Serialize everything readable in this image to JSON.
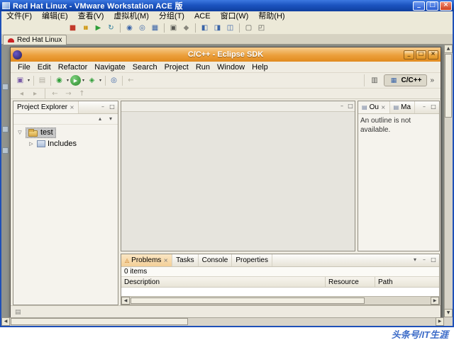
{
  "vmware": {
    "title": "Red Hat Linux - VMware Workstation ACE 版",
    "menu": [
      "文件(F)",
      "编辑(E)",
      "查看(V)",
      "虚拟机(M)",
      "分组(T)",
      "ACE",
      "窗口(W)",
      "帮助(H)"
    ],
    "tab_label": "Red Hat Linux"
  },
  "eclipse": {
    "title": "C/C++ - Eclipse SDK",
    "menu": [
      "File",
      "Edit",
      "Refactor",
      "Navigate",
      "Search",
      "Project",
      "Run",
      "Window",
      "Help"
    ],
    "perspective": "C/C++",
    "project_explorer": {
      "title": "Project Explorer",
      "project": "test",
      "child": "Includes"
    },
    "outline": {
      "tab_outline": "Ou",
      "tab_make": "Ma",
      "message": "An outline is not available."
    },
    "bottom": {
      "tab_problems": "Problems",
      "tab_tasks": "Tasks",
      "tab_console": "Console",
      "tab_properties": "Properties",
      "items_label": "0 items",
      "col_description": "Description",
      "col_resource": "Resource",
      "col_path": "Path"
    }
  },
  "watermark": "头条号/IT生涯",
  "glyphs": {
    "minimize": "_",
    "maximize": "□",
    "close": "×",
    "power_off": "■",
    "suspend": "▮▮",
    "power_on": "▶",
    "reset": "↻",
    "snapshot": "◉",
    "revert_snapshot": "◎",
    "snapshot_manager": "▦",
    "settings": "▣",
    "clone": "◆",
    "summary_view": "◧",
    "console_view": "◨",
    "devices_view": "◫",
    "fullscreen": "▢",
    "quick_switch": "◰",
    "new_wizard": "▣",
    "save": "▤",
    "debug": "◉",
    "run": "▶",
    "external_tools": "◈",
    "search": "◎",
    "dropdown": "▾",
    "back": "←",
    "forward": "→",
    "up_arrow": "↑",
    "prev": "◂",
    "next": "▸",
    "collapse_all": "▴",
    "view_menu": "▾",
    "min_view": "–",
    "max_view": "□",
    "tab_close": "×",
    "problems_icon": "◬",
    "view_tab_icon": "▤",
    "view_layout": "▥",
    "persp_icon": "▦",
    "overflow": "»",
    "status_icon": "▤",
    "scroll_up": "▲",
    "scroll_down": "▼",
    "scroll_left": "◀",
    "scroll_right": "▶",
    "expanded": "▽",
    "collapsed": "▷"
  }
}
